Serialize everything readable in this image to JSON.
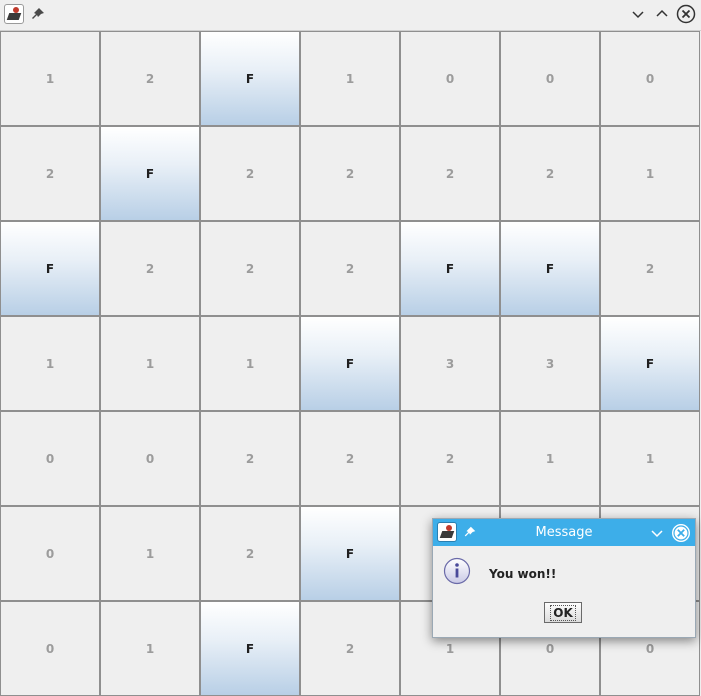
{
  "window": {
    "icon": "java-app-icon",
    "pin": "pin-icon",
    "controls": [
      "minimize-icon",
      "maximize-icon",
      "close-icon"
    ]
  },
  "board": {
    "rows": [
      [
        "1",
        "2",
        "F",
        "1",
        "0",
        "0",
        "0"
      ],
      [
        "2",
        "F",
        "2",
        "2",
        "2",
        "2",
        "1"
      ],
      [
        "F",
        "2",
        "2",
        "2",
        "F",
        "F",
        "2"
      ],
      [
        "1",
        "1",
        "1",
        "F",
        "3",
        "3",
        "F"
      ],
      [
        "0",
        "0",
        "2",
        "2",
        "2",
        "1",
        "1"
      ],
      [
        "0",
        "1",
        "2",
        "F",
        "",
        "",
        ""
      ],
      [
        "0",
        "1",
        "F",
        "2",
        "1",
        "0",
        "0"
      ]
    ]
  },
  "dialog": {
    "title": "Message",
    "message": "You won!!",
    "ok_label": "OK",
    "icon": "info-icon"
  },
  "colors": {
    "accent": "#3daee9",
    "cell_bg": "#efefef",
    "flag_top": "#ffffff",
    "flag_bottom": "#b8cfe6"
  }
}
